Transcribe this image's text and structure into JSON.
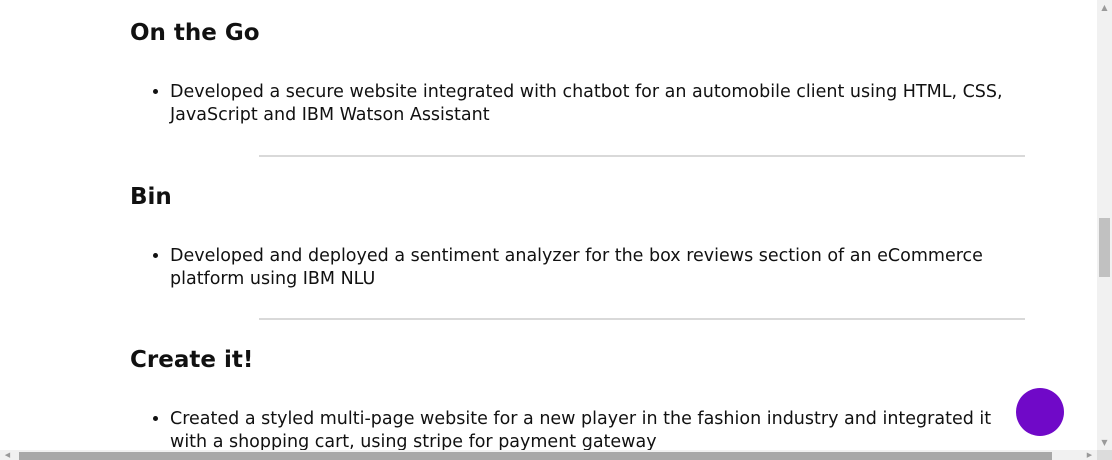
{
  "projects": [
    {
      "title": "On the Go",
      "bullets": [
        "Developed a secure website integrated with chatbot for an automobile client using HTML, CSS, JavaScript and IBM Watson Assistant"
      ]
    },
    {
      "title": "Bin",
      "bullets": [
        "Developed and deployed a sentiment analyzer for the box reviews section of an eCommerce platform using IBM NLU"
      ]
    },
    {
      "title": "Create it!",
      "bullets": [
        "Created a styled multi-page website for a new player in the fashion industry and integrated it with a shopping cart, using stripe for payment gateway"
      ]
    }
  ],
  "chat_widget": {
    "color": "#7009c8",
    "icon": "chat-bubble-icon"
  },
  "scrollbars": {
    "vertical_arrows": [
      "▲",
      "▼"
    ],
    "horizontal_arrows": [
      "◀",
      "▶"
    ]
  }
}
